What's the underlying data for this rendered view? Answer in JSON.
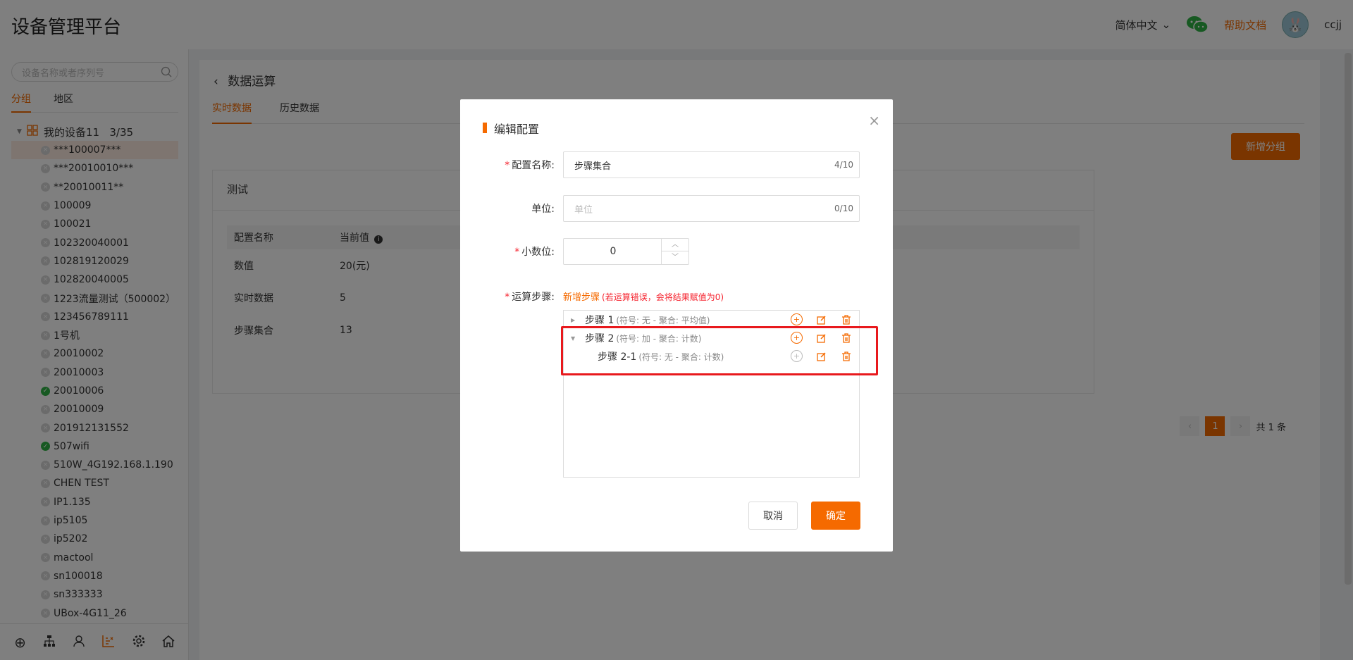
{
  "app": {
    "title": "设备管理平台",
    "language": "简体中文",
    "help": "帮助文档",
    "username": "ccjj"
  },
  "sidebar": {
    "search_placeholder": "设备名称或者序列号",
    "tabs": [
      "分组",
      "地区"
    ],
    "root": "我的设备11   3/35",
    "items": [
      {
        "label": "***100007***",
        "status": "offline"
      },
      {
        "label": "***20010010***",
        "status": "offline"
      },
      {
        "label": "**20010011**",
        "status": "offline"
      },
      {
        "label": "100009",
        "status": "offline"
      },
      {
        "label": "100021",
        "status": "offline"
      },
      {
        "label": "102320040001",
        "status": "offline"
      },
      {
        "label": "102819120029",
        "status": "offline"
      },
      {
        "label": "102820040005",
        "status": "offline"
      },
      {
        "label": "1223流量测试（500002）",
        "status": "offline"
      },
      {
        "label": "123456789111",
        "status": "offline"
      },
      {
        "label": "1号机",
        "status": "offline"
      },
      {
        "label": "20010002",
        "status": "offline"
      },
      {
        "label": "20010003",
        "status": "offline"
      },
      {
        "label": "20010006",
        "status": "online"
      },
      {
        "label": "20010009",
        "status": "offline"
      },
      {
        "label": "201912131552",
        "status": "offline"
      },
      {
        "label": "507wifi",
        "status": "online"
      },
      {
        "label": "510W_4G192.168.1.190",
        "status": "offline"
      },
      {
        "label": "CHEN TEST",
        "status": "offline"
      },
      {
        "label": "IP1.135",
        "status": "offline"
      },
      {
        "label": "ip5105",
        "status": "offline"
      },
      {
        "label": "ip5202",
        "status": "offline"
      },
      {
        "label": "mactool",
        "status": "offline"
      },
      {
        "label": "sn100018",
        "status": "offline"
      },
      {
        "label": "sn333333",
        "status": "offline"
      },
      {
        "label": "UBox-4G11_26",
        "status": "offline"
      }
    ]
  },
  "main": {
    "breadcrumb": "数据运算",
    "tabs": [
      "实时数据",
      "历史数据"
    ],
    "add_group": "新增分组",
    "card_title": "测试",
    "table": {
      "headers": [
        "配置名称",
        "当前值"
      ],
      "rows": [
        [
          "数值",
          "20(元)"
        ],
        [
          "实时数据",
          "5"
        ],
        [
          "步骤集合",
          "13"
        ]
      ]
    },
    "pager": {
      "current": "1",
      "total": "共 1 条"
    }
  },
  "dialog": {
    "title": "编辑配置",
    "name_label": "配置名称:",
    "name_value": "步骤集合",
    "name_count": "4/10",
    "unit_label": "单位:",
    "unit_placeholder": "单位",
    "unit_count": "0/10",
    "decimal_label": "小数位:",
    "decimal_value": "0",
    "steps_label": "运算步骤:",
    "add_step": "新增步骤",
    "add_step_hint": "(若运算错误，会将结果赋值为0)",
    "steps": [
      {
        "name": "步骤 1",
        "meta": "(符号: 无 - 聚合: 平均值)"
      },
      {
        "name": "步骤 2",
        "meta": "(符号: 加 - 聚合: 计数)"
      },
      {
        "name": "步骤 2-1",
        "meta": "(符号: 无 - 聚合: 计数)"
      }
    ],
    "cancel": "取消",
    "confirm": "确定"
  },
  "colors": {
    "accent": "#f56a00",
    "online": "#2fb344",
    "highlight": "#e8191d"
  }
}
